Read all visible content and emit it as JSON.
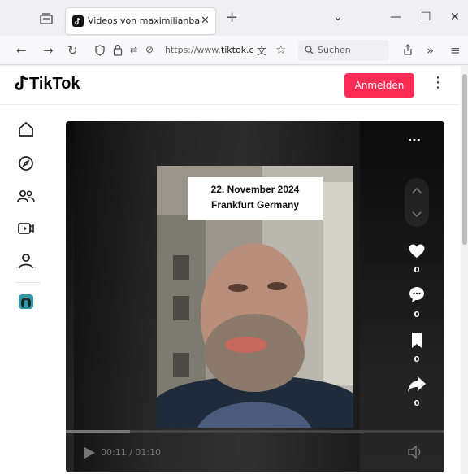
{
  "browser": {
    "tab_title": "Videos von maximilianbaehring",
    "url_prefix": "https://www.",
    "url_domain": "tiktok.c",
    "search_placeholder": "Suchen",
    "new_tab": "+",
    "close_tab": "✕"
  },
  "header": {
    "logo_text": "TikTok",
    "login_label": "Anmelden",
    "more_glyph": "⋮"
  },
  "sidebar": {
    "items": [
      {
        "icon": "home-icon"
      },
      {
        "icon": "explore-icon"
      },
      {
        "icon": "following-icon"
      },
      {
        "icon": "live-icon"
      },
      {
        "icon": "profile-icon"
      },
      {
        "icon": "avatar-icon"
      }
    ]
  },
  "video": {
    "caption_line1": "22. November 2024",
    "caption_line2": "Frankfurt Germany",
    "time": "00:11 / 01:10",
    "progress": 0.17,
    "likes": "0",
    "comments": "0",
    "saves": "0",
    "shares": "0"
  },
  "colors": {
    "brand": "#fe2c55"
  }
}
